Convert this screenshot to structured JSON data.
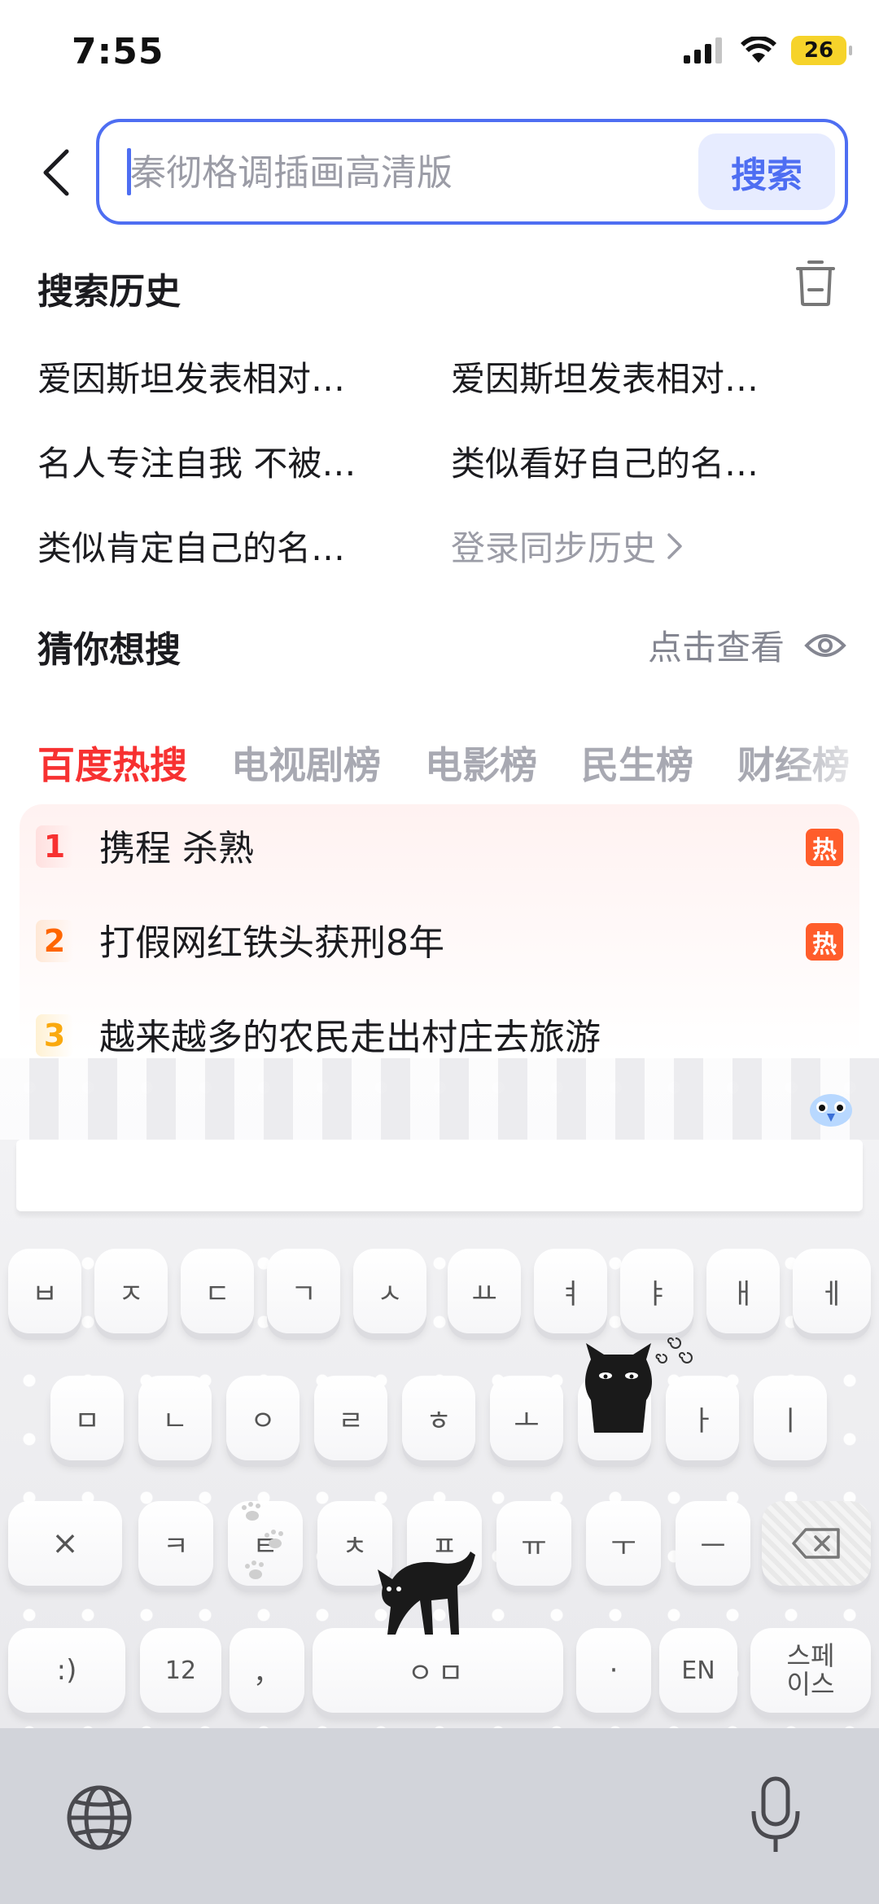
{
  "status_bar": {
    "time": "7:55",
    "battery": "26"
  },
  "search": {
    "placeholder": "秦彻格调插画高清版",
    "button_label": "搜索"
  },
  "history": {
    "title": "搜索历史",
    "items": [
      "爱因斯坦发表相对…",
      "爱因斯坦发表相对…",
      "名人专注自我 不被…",
      "类似看好自己的名…",
      "类似肯定自己的名…"
    ],
    "login_sync": "登录同步历史"
  },
  "guess": {
    "title": "猜你想搜",
    "toggle_label": "点击查看"
  },
  "hot_tabs": [
    "百度热搜",
    "电视剧榜",
    "电影榜",
    "民生榜",
    "财经榜"
  ],
  "hot_list": [
    {
      "rank": "1",
      "text": "携程 杀熟",
      "badge": "热"
    },
    {
      "rank": "2",
      "text": "打假网红铁头获刑8年",
      "badge": "热"
    },
    {
      "rank": "3",
      "text": "越来越多的农民走出村庄去旅游",
      "badge": ""
    }
  ],
  "keyboard": {
    "row1": [
      "ㅂ",
      "ㅈ",
      "ㄷ",
      "ㄱ",
      "ㅅ",
      "ㅛ",
      "ㅕ",
      "ㅑ",
      "ㅐ",
      "ㅔ"
    ],
    "row2": [
      "ㅁ",
      "ㄴ",
      "ㅇ",
      "ㄹ",
      "ㅎ",
      "ㅗ",
      "ㅓ",
      "ㅏ",
      "ㅣ"
    ],
    "row3": [
      "×",
      "ㅋ",
      "ㅌ",
      "ㅊ",
      "ㅍ",
      "ㅠ",
      "ㅜ",
      "ㅡ"
    ],
    "row4": {
      "emoji": ":)",
      "numbers": "12",
      "comma": "，",
      "space": "ㅇㅁ",
      "period": "·",
      "lang": "EN",
      "spacebar_label_1": "스페",
      "spacebar_label_2": "이스"
    }
  },
  "colors": {
    "accent": "#4e6ef2",
    "hot_red": "#f73131",
    "rank2": "#ff6600",
    "rank3": "#faa90e",
    "badge": "#ff5d2b"
  },
  "icons": [
    "back-icon",
    "trash-icon",
    "eye-icon",
    "chevron-right-icon",
    "globe-icon",
    "microphone-icon",
    "backspace-icon",
    "cat-sticker",
    "paw-prints",
    "mascot-icon",
    "signal-icon",
    "wifi-icon"
  ]
}
